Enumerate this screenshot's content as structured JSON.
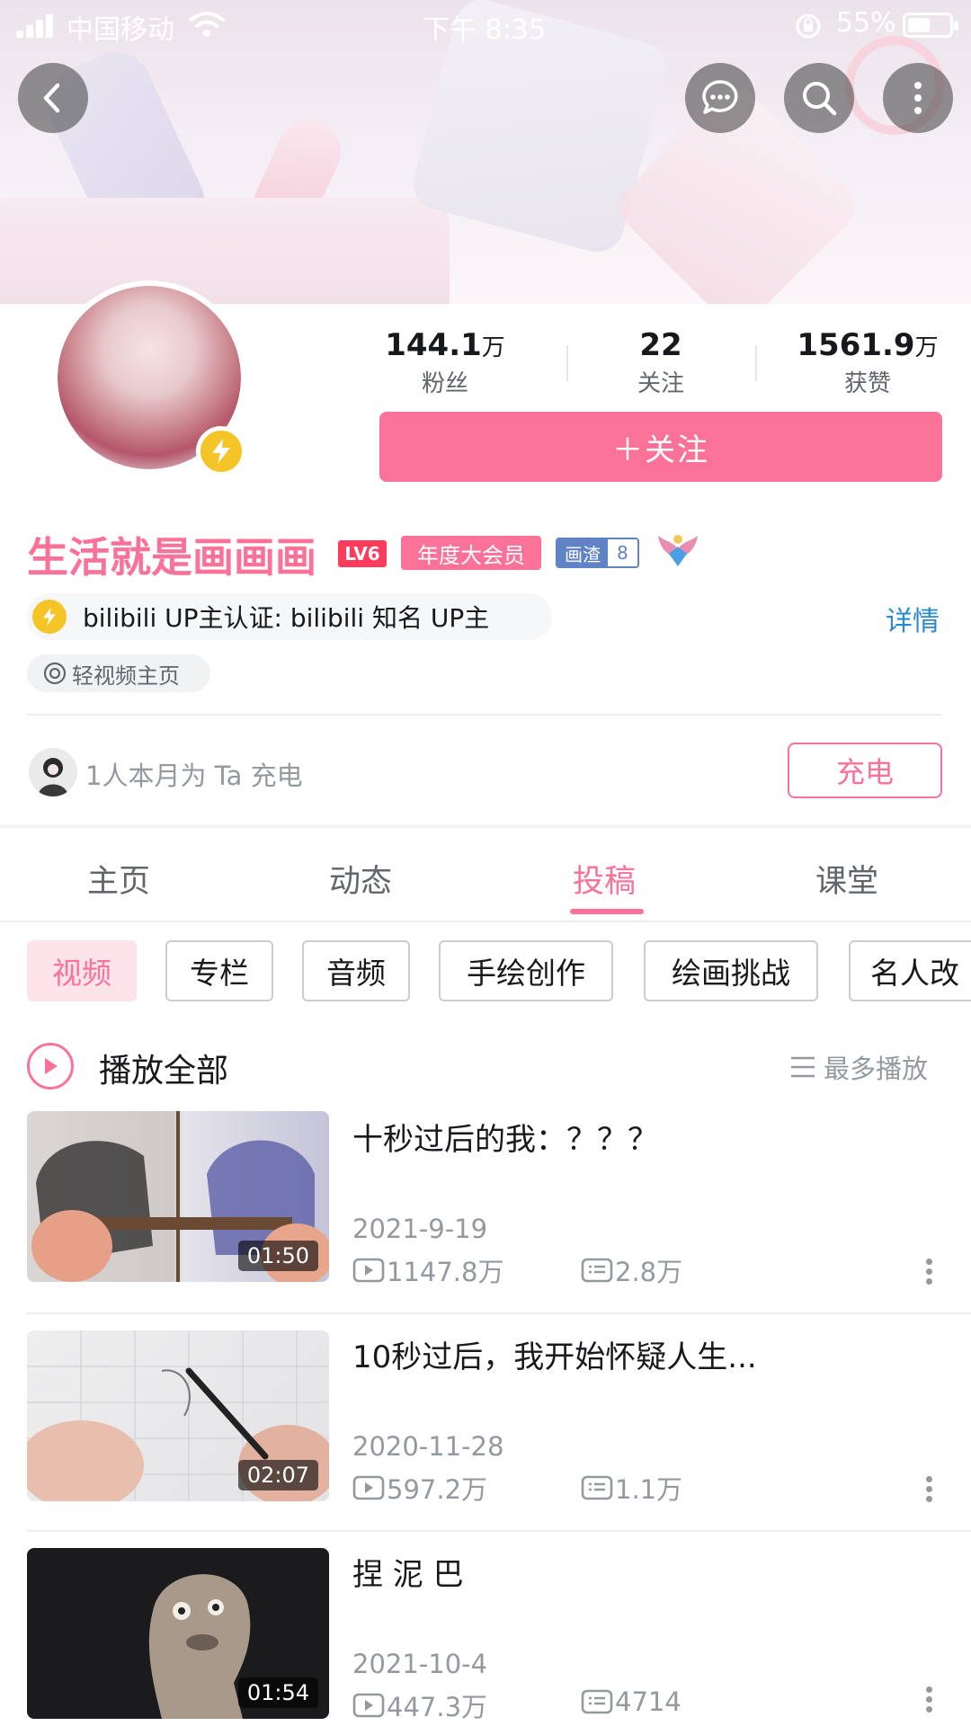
{
  "status_bar": {
    "carrier": "中国移动",
    "time": "下午 8:35",
    "battery": "55%",
    "battery_level": 0.55
  },
  "colors": {
    "accent": "#fb7299",
    "link": "#2a8ad0",
    "text_secondary": "#9499a0"
  },
  "header_icons": [
    "back-icon",
    "message-icon",
    "search-icon",
    "more-icon"
  ],
  "profile": {
    "stats": [
      {
        "num": "144.1",
        "unit": "万",
        "label": "粉丝"
      },
      {
        "num": "22",
        "unit": "",
        "label": "关注"
      },
      {
        "num": "1561.9",
        "unit": "万",
        "label": "获赞"
      }
    ],
    "follow_label": "＋关注",
    "name": "生活就是画画画",
    "level": "LV6",
    "vip_label": "年度大会员",
    "medal_name": "画渣",
    "medal_level": "8",
    "certification": "bilibili UP主认证: bilibili 知名 UP主",
    "detail_link": "详情",
    "light_video": "轻视频主页"
  },
  "charge": {
    "text": "1人本月为 Ta 充电",
    "button": "充电"
  },
  "tabs": [
    {
      "label": "主页",
      "active": false
    },
    {
      "label": "动态",
      "active": false
    },
    {
      "label": "投稿",
      "active": true
    },
    {
      "label": "课堂",
      "active": false
    }
  ],
  "chips": [
    {
      "label": "视频",
      "active": true
    },
    {
      "label": "专栏",
      "active": false
    },
    {
      "label": "音频",
      "active": false
    },
    {
      "label": "手绘创作",
      "active": false
    },
    {
      "label": "绘画挑战",
      "active": false
    },
    {
      "label": "名人改",
      "active": false
    }
  ],
  "list_header": {
    "play_all": "播放全部",
    "sort": "最多播放"
  },
  "videos": [
    {
      "title": "十秒过后的我：？？？",
      "date": "2021-9-19",
      "views": "1147.8万",
      "danmaku": "2.8万",
      "duration": "01:50"
    },
    {
      "title": "10秒过后，我开始怀疑人生...",
      "date": "2020-11-28",
      "views": "597.2万",
      "danmaku": "1.1万",
      "duration": "02:07"
    },
    {
      "title": "捏 泥 巴",
      "date": "2021-10-4",
      "views": "447.3万",
      "danmaku": "4714",
      "duration": "01:54"
    }
  ]
}
